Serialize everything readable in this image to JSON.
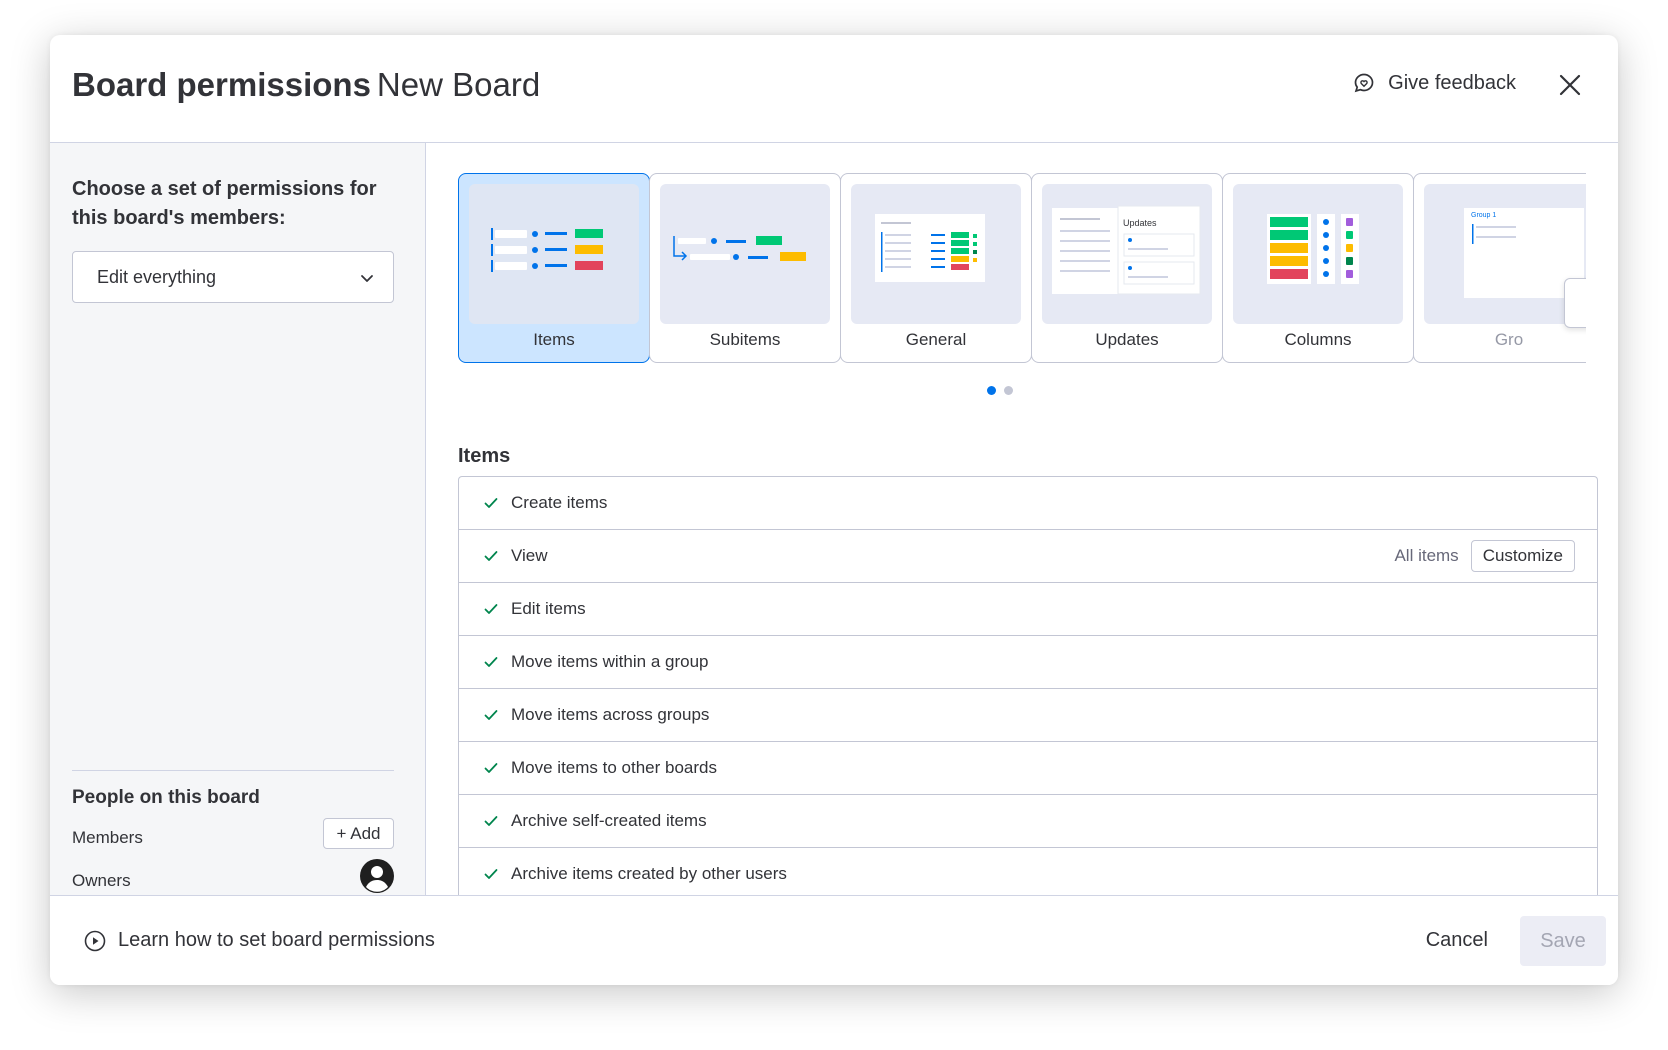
{
  "header": {
    "title_bold": "Board permissions",
    "title_board": "New Board",
    "feedback_label": "Give feedback",
    "icons": {
      "feedback": "chat-heart-icon",
      "close": "close-icon"
    }
  },
  "left": {
    "choose_label": "Choose a set of permissions for this board's members:",
    "dropdown_value": "Edit everything",
    "people_title": "People on this board",
    "members_label": "Members",
    "add_label": "+ Add",
    "owners_label": "Owners"
  },
  "carousel": {
    "cards": [
      {
        "label": "Items",
        "active": true
      },
      {
        "label": "Subitems",
        "active": false
      },
      {
        "label": "General",
        "active": false
      },
      {
        "label": "Updates",
        "active": false
      },
      {
        "label": "Columns",
        "active": false
      },
      {
        "label": "Gro",
        "active": false
      }
    ],
    "thumb_updates_text": "Updates",
    "thumb_group_text": "Group 1",
    "dots": {
      "count": 2,
      "active": 0
    }
  },
  "section": {
    "title": "Items",
    "rows": [
      {
        "label": "Create items"
      },
      {
        "label": "View",
        "scope": "All items",
        "action": "Customize"
      },
      {
        "label": "Edit items"
      },
      {
        "label": "Move items within a group"
      },
      {
        "label": "Move items across groups"
      },
      {
        "label": "Move items to other boards"
      },
      {
        "label": "Archive self-created items"
      },
      {
        "label": "Archive items created by other users"
      }
    ]
  },
  "footer": {
    "learn_label": "Learn how to set board permissions",
    "cancel_label": "Cancel",
    "save_label": "Save"
  },
  "colors": {
    "primary": "#0073ea",
    "active_card_bg": "#cce5ff",
    "check": "#00854d",
    "status_green": "#00c875",
    "status_yellow": "#fdbc00",
    "status_red": "#e2445c",
    "border": "#c3c6d4"
  }
}
